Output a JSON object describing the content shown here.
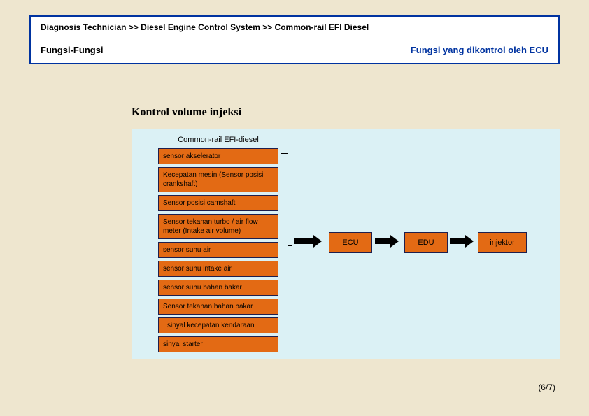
{
  "header": {
    "breadcrumb": "Diagnosis Technician >> Diesel Engine Control System >> Common-rail EFI Diesel",
    "left_title": "Fungsi-Fungsi",
    "right_title": "Fungsi yang dikontrol oleh ECU"
  },
  "body": {
    "heading": "Kontrol volume injeksi"
  },
  "diagram": {
    "sub_heading": "Common-rail EFI-diesel",
    "sensors": [
      "sensor akselerator",
      "Kecepatan mesin (Sensor posisi crankshaft)",
      "Sensor posisi camshaft",
      "Sensor tekanan turbo / air flow meter (Intake air volume)",
      "sensor suhu air",
      "sensor suhu intake air",
      "sensor suhu bahan bakar",
      "Sensor tekanan bahan bakar",
      "sinyal kecepatan kendaraan",
      "sinyal starter"
    ],
    "outputs": {
      "ecu": "ECU",
      "edu": "EDU",
      "inj": "injektor"
    }
  },
  "page": "(6/7)"
}
